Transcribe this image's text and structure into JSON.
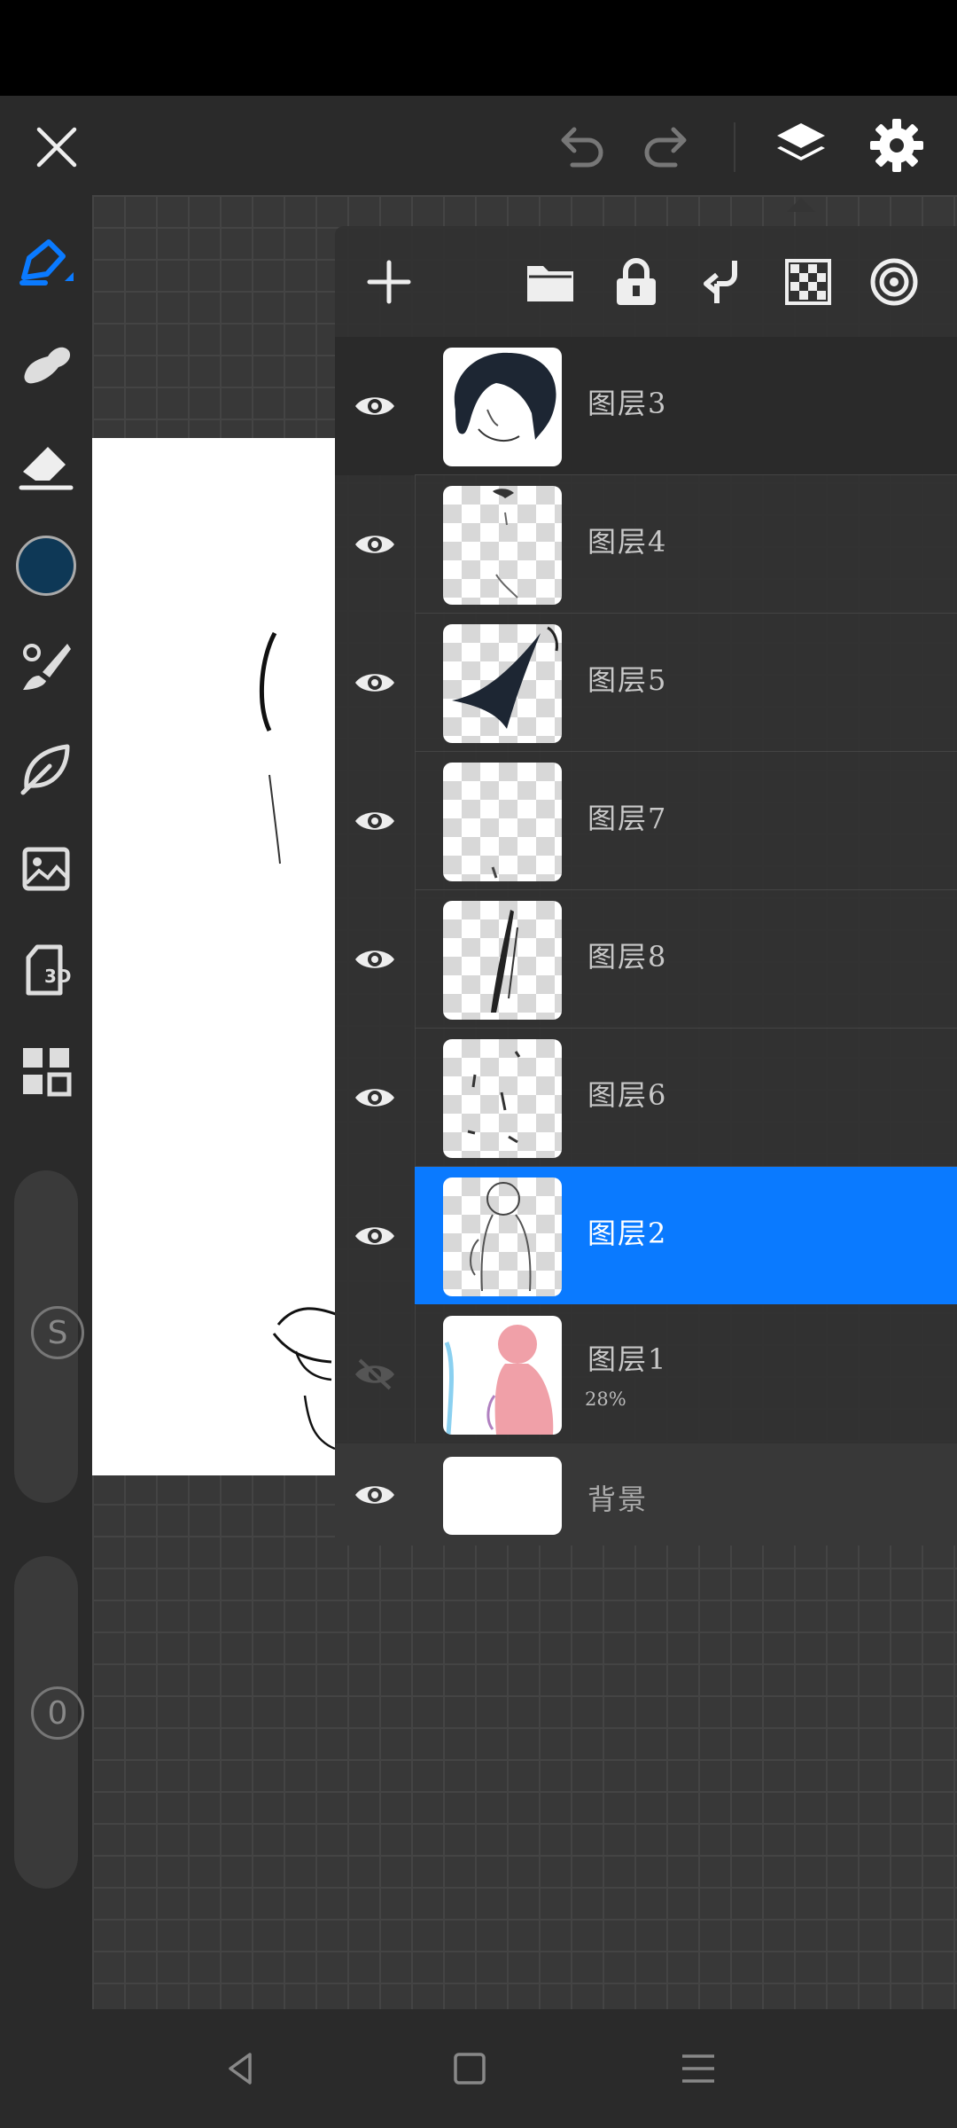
{
  "colors": {
    "accent": "#0a7aff",
    "current_color": "#0e3856",
    "toolbar_bg": "#2a2a2a",
    "panel_bg": "#303030"
  },
  "toolbar": {
    "icons": [
      "close-icon",
      "undo-icon",
      "redo-icon",
      "layers-icon",
      "settings-icon"
    ]
  },
  "tools": [
    "pen-tool-icon",
    "smudge-tool-icon",
    "eraser-tool-icon",
    "color-swatch",
    "brush-library-icon",
    "leaf-icon",
    "image-import-icon",
    "3d-model-icon",
    "grid-layout-icon"
  ],
  "sliders": {
    "size_label": "S",
    "opacity_label": "0"
  },
  "layer_panel": {
    "actions": [
      "add-layer-icon",
      "folder-icon",
      "lock-icon",
      "merge-down-icon",
      "transparency-icon",
      "target-icon"
    ],
    "layers": [
      {
        "name": "图层3",
        "visible": true
      },
      {
        "name": "图层4",
        "visible": true
      },
      {
        "name": "图层5",
        "visible": true
      },
      {
        "name": "图层7",
        "visible": true
      },
      {
        "name": "图层8",
        "visible": true
      },
      {
        "name": "图层6",
        "visible": true
      },
      {
        "name": "图层2",
        "visible": true,
        "selected": true
      },
      {
        "name": "图层1",
        "visible": false,
        "opacity": "28%"
      },
      {
        "name": "背景",
        "visible": true,
        "background": true
      }
    ]
  },
  "navigation": [
    "back-icon",
    "home-icon",
    "menu-icon"
  ]
}
